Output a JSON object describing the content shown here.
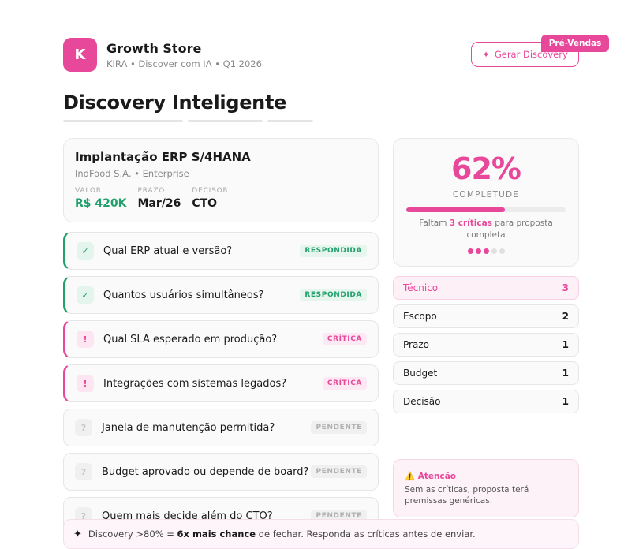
{
  "header": {
    "logo_letter": "K",
    "brand_name": "Growth Store",
    "brand_sub": "KIRA • Discover com IA • Q1 2026",
    "generate_label": "Gerar Discovery",
    "pre_sales_badge": "Pré-Vendas"
  },
  "page_title": "Discovery Inteligente",
  "deal": {
    "title": "Implantação ERP S/4HANA",
    "subtitle": "IndFood S.A. • Enterprise",
    "metrics": [
      {
        "label": "VALOR",
        "value": "R$ 420K"
      },
      {
        "label": "PRAZO",
        "value": "Mar/26"
      },
      {
        "label": "DECISOR",
        "value": "CTO"
      }
    ]
  },
  "questions": [
    {
      "icon": "✓",
      "text": "Qual ERP atual e versão?",
      "status": "RESPONDIDA"
    },
    {
      "icon": "✓",
      "text": "Quantos usuários simultâneos?",
      "status": "RESPONDIDA"
    },
    {
      "icon": "!",
      "text": "Qual SLA esperado em produção?",
      "status": "CRÍTICA"
    },
    {
      "icon": "!",
      "text": "Integrações com sistemas legados?",
      "status": "CRÍTICA"
    },
    {
      "icon": "?",
      "text": "Janela de manutenção permitida?",
      "status": "PENDENTE"
    },
    {
      "icon": "?",
      "text": "Budget aprovado ou depende de board?",
      "status": "PENDENTE"
    },
    {
      "icon": "?",
      "text": "Quem mais decide além do CTO?",
      "status": "PENDENTE"
    }
  ],
  "completeness": {
    "percent_text": "62%",
    "percent_value": 62,
    "label": "COMPLETUDE",
    "note_prefix": "Faltam ",
    "note_bold": "3 críticas",
    "note_suffix": " para proposta completa",
    "dots_total": 5,
    "dots_active": 3
  },
  "categories": [
    {
      "name": "Técnico",
      "count": "3"
    },
    {
      "name": "Escopo",
      "count": "2"
    },
    {
      "name": "Prazo",
      "count": "1"
    },
    {
      "name": "Budget",
      "count": "1"
    },
    {
      "name": "Decisão",
      "count": "1"
    }
  ],
  "alert": {
    "title": "⚠️ Atenção",
    "text": "Sem as críticas, proposta terá premissas genéricas."
  },
  "footer": {
    "prefix": "Discovery >80% = ",
    "bold": "6x mais chance",
    "suffix": " de fechar. Responda as críticas antes de enviar."
  },
  "colors": {
    "accent": "#e8489a",
    "success": "#22a06b"
  }
}
